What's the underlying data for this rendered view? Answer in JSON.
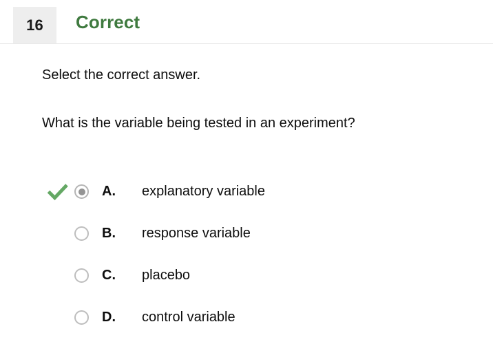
{
  "header": {
    "question_number": "16",
    "status": "Correct",
    "status_color": "#3f7a3f",
    "badge_bg": "#eeeeee"
  },
  "body": {
    "instruction": "Select the correct answer.",
    "question": "What is the variable being tested in an experiment?"
  },
  "options": [
    {
      "letter": "A.",
      "text": "explanatory variable",
      "selected": true,
      "correct": true,
      "radio_icon": "radio-selected-icon",
      "check_icon": "check-mark-icon"
    },
    {
      "letter": "B.",
      "text": "response variable",
      "selected": false,
      "correct": false,
      "radio_icon": "radio-empty-icon"
    },
    {
      "letter": "C.",
      "text": "placebo",
      "selected": false,
      "correct": false,
      "radio_icon": "radio-empty-icon"
    },
    {
      "letter": "D.",
      "text": "control variable",
      "selected": false,
      "correct": false,
      "radio_icon": "radio-empty-icon"
    }
  ],
  "colors": {
    "check_green": "#64a864",
    "radio_ring": "#bdbdbd",
    "radio_dot": "#949494",
    "text": "#0d0d0d",
    "divider": "#e8e8e8"
  }
}
